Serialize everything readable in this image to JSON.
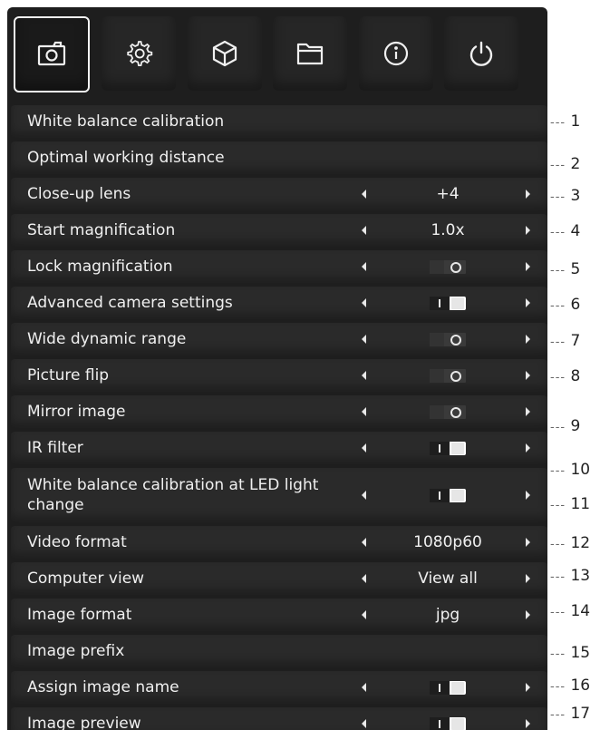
{
  "tabs": [
    {
      "icon": "camera-icon",
      "active": true
    },
    {
      "icon": "gear-icon",
      "active": false
    },
    {
      "icon": "cube-icon",
      "active": false
    },
    {
      "icon": "folder-icon",
      "active": false
    },
    {
      "icon": "info-icon",
      "active": false
    },
    {
      "icon": "power-icon",
      "active": false
    }
  ],
  "menu": {
    "white_balance_calibration": {
      "label": "White balance calibration"
    },
    "optimal_working_distance": {
      "label": "Optimal working distance"
    },
    "close_up_lens": {
      "label": "Close-up lens",
      "value": "+4"
    },
    "start_magnification": {
      "label": "Start magnification",
      "value": "1.0x"
    },
    "lock_magnification": {
      "label": "Lock magnification",
      "toggle": "off"
    },
    "advanced_camera_settings": {
      "label": "Advanced camera settings",
      "toggle": "on"
    },
    "wide_dynamic_range": {
      "label": "Wide dynamic range",
      "toggle": "off"
    },
    "picture_flip": {
      "label": "Picture flip",
      "toggle": "off"
    },
    "mirror_image": {
      "label": "Mirror image",
      "toggle": "off"
    },
    "ir_filter": {
      "label": "IR filter",
      "toggle": "on"
    },
    "wb_at_led_change": {
      "label": "White balance calibration at LED light change",
      "toggle": "on"
    },
    "video_format": {
      "label": "Video format",
      "value": "1080p60"
    },
    "computer_view": {
      "label": "Computer view",
      "value": "View all"
    },
    "image_format": {
      "label": "Image format",
      "value": "jpg"
    },
    "image_prefix": {
      "label": "Image prefix"
    },
    "assign_image_name": {
      "label": "Assign image name",
      "toggle": "on"
    },
    "image_preview": {
      "label": "Image preview",
      "toggle": "on"
    }
  },
  "callouts": [
    "1",
    "2",
    "3",
    "4",
    "5",
    "6",
    "7",
    "8",
    "9",
    "10",
    "11",
    "12",
    "13",
    "14",
    "15",
    "16",
    "17"
  ],
  "colors": {
    "panel": "#1e1e1e",
    "row": "#2a2a2a",
    "text": "#f0f0f0",
    "active_border": "#f2f2f2"
  }
}
